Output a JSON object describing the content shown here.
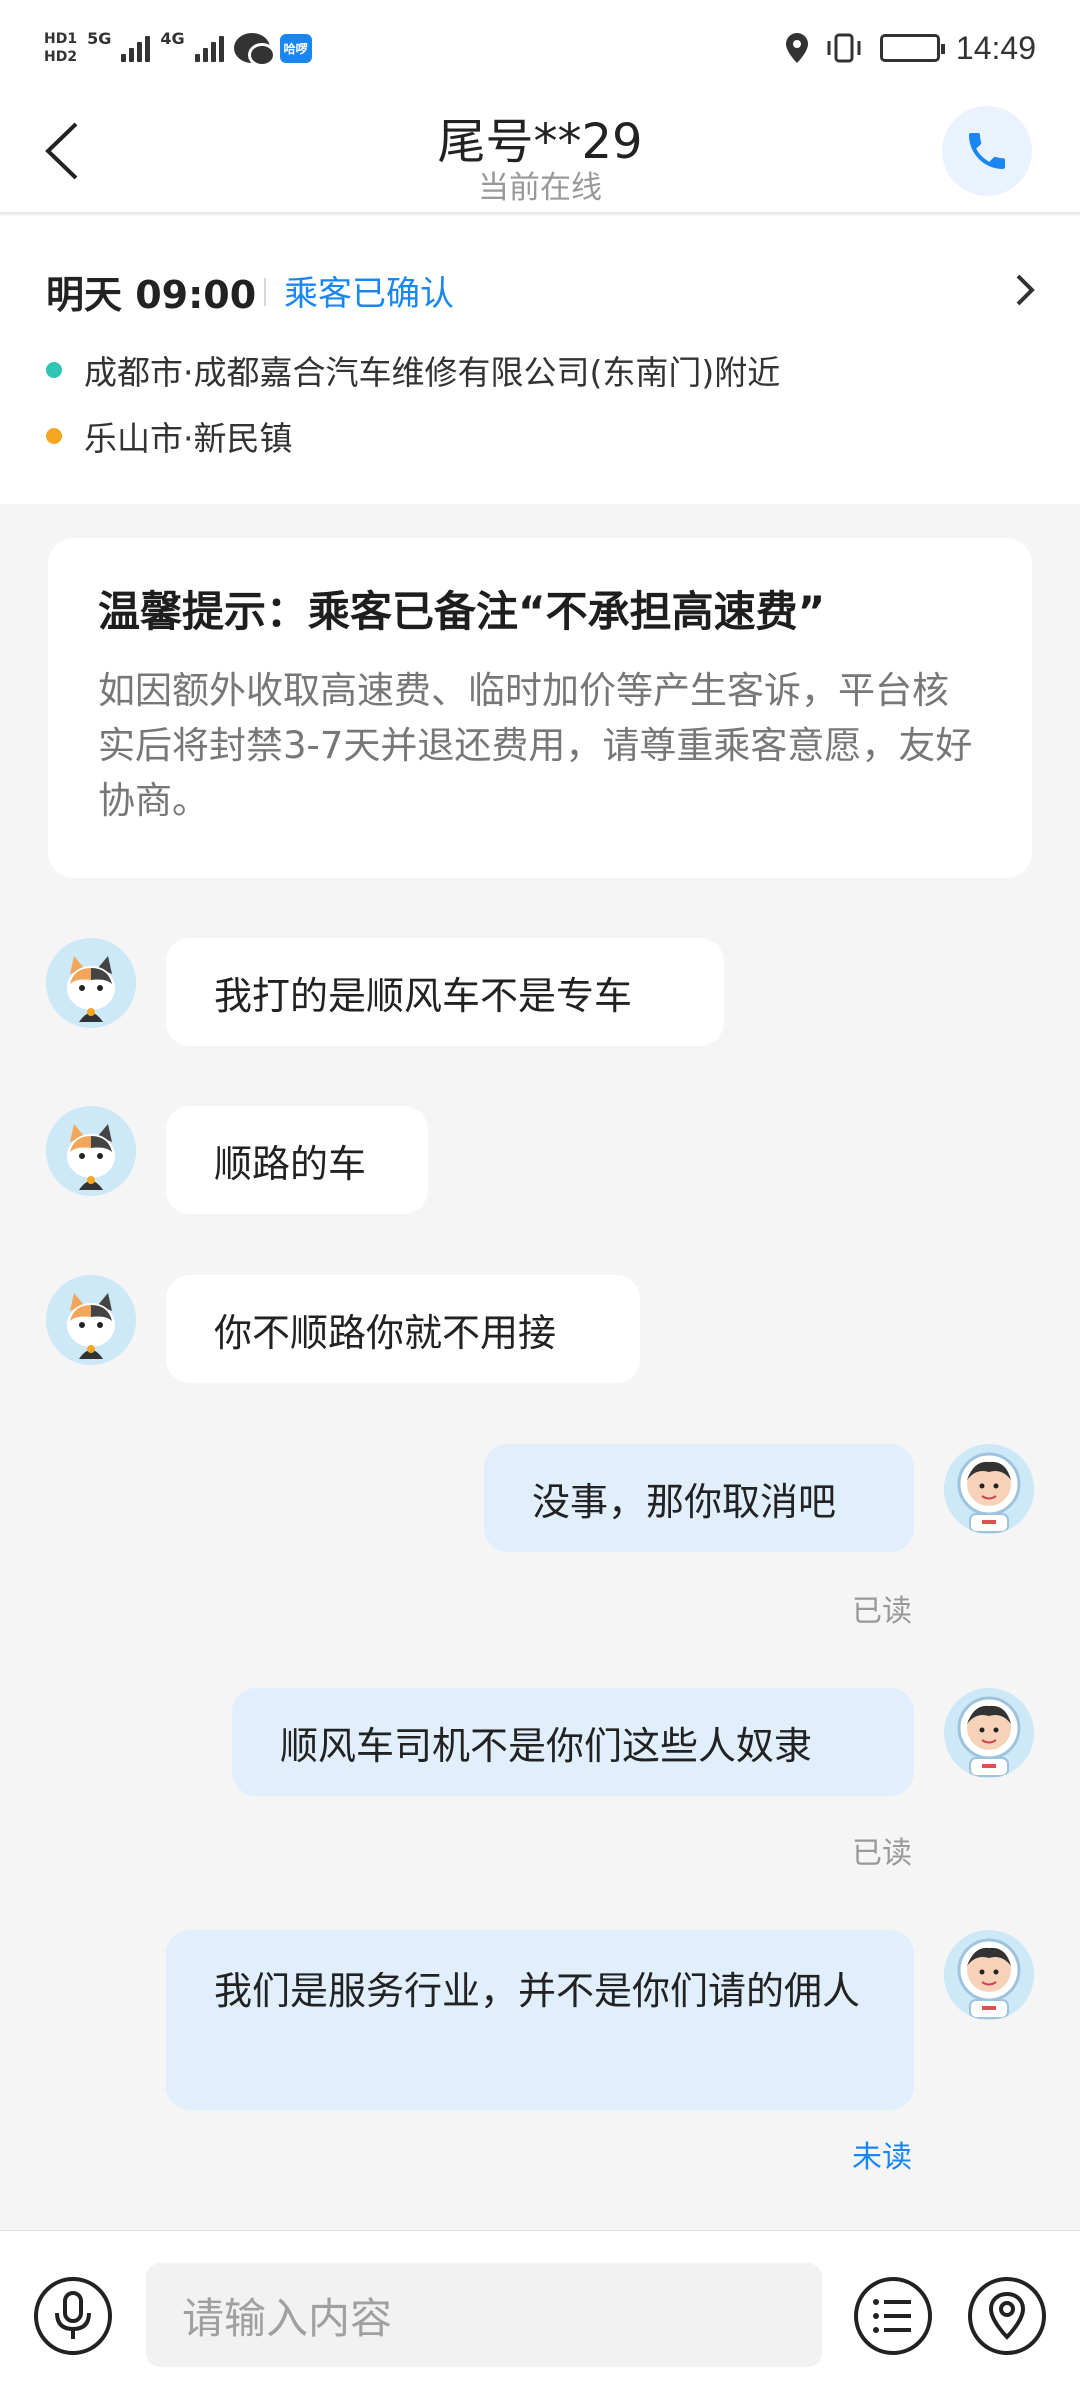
{
  "status_bar": {
    "hd1": "HD1",
    "hd2": "HD2",
    "net1": "5G",
    "net2": "4G",
    "app_badge": "哈啰",
    "time": "14:49"
  },
  "header": {
    "title": "尾号**29",
    "subtitle": "当前在线"
  },
  "trip": {
    "time": "明天 09:00",
    "status": "乘客已确认",
    "from": "成都市·成都嘉合汽车维修有限公司(东南门)附近",
    "to": "乐山市·新民镇",
    "colors": {
      "from_dot": "#2ec4b6",
      "to_dot": "#f5a623",
      "status": "#1a86f2"
    }
  },
  "tip": {
    "title": "温馨提示：乘客已备注“不承担高速费”",
    "body": "如因额外收取高速费、临时加价等产生客诉，平台核实后将封禁3-7天并退还费用，请尊重乘客意愿，友好协商。"
  },
  "messages": [
    {
      "side": "incoming",
      "text": "我打的是顺风车不是专车",
      "avatar": "cat-avatar-icon"
    },
    {
      "side": "incoming",
      "text": "顺路的车",
      "avatar": "cat-avatar-icon"
    },
    {
      "side": "incoming",
      "text": "你不顺路你就不用接",
      "avatar": "cat-avatar-icon"
    },
    {
      "side": "outgoing",
      "text": "没事，那你取消吧",
      "status": "已读",
      "avatar": "astronaut-avatar-icon"
    },
    {
      "side": "outgoing",
      "text": "顺风车司机不是你们这些人奴隶",
      "status": "已读",
      "avatar": "astronaut-avatar-icon"
    },
    {
      "side": "outgoing",
      "text": "我们是服务行业，并不是你们请的佣人",
      "status": "未读",
      "avatar": "astronaut-avatar-icon"
    }
  ],
  "input": {
    "placeholder": "请输入内容"
  },
  "icons": {
    "back": "back-arrow-icon",
    "phone": "phone-icon",
    "mic": "microphone-icon",
    "menu": "list-menu-icon",
    "location": "location-pin-icon"
  },
  "colors": {
    "accent": "#1a86f2",
    "outgoing_bubble": "#e1eefc",
    "incoming_bubble": "#ffffff",
    "background": "#f5f5f5"
  }
}
